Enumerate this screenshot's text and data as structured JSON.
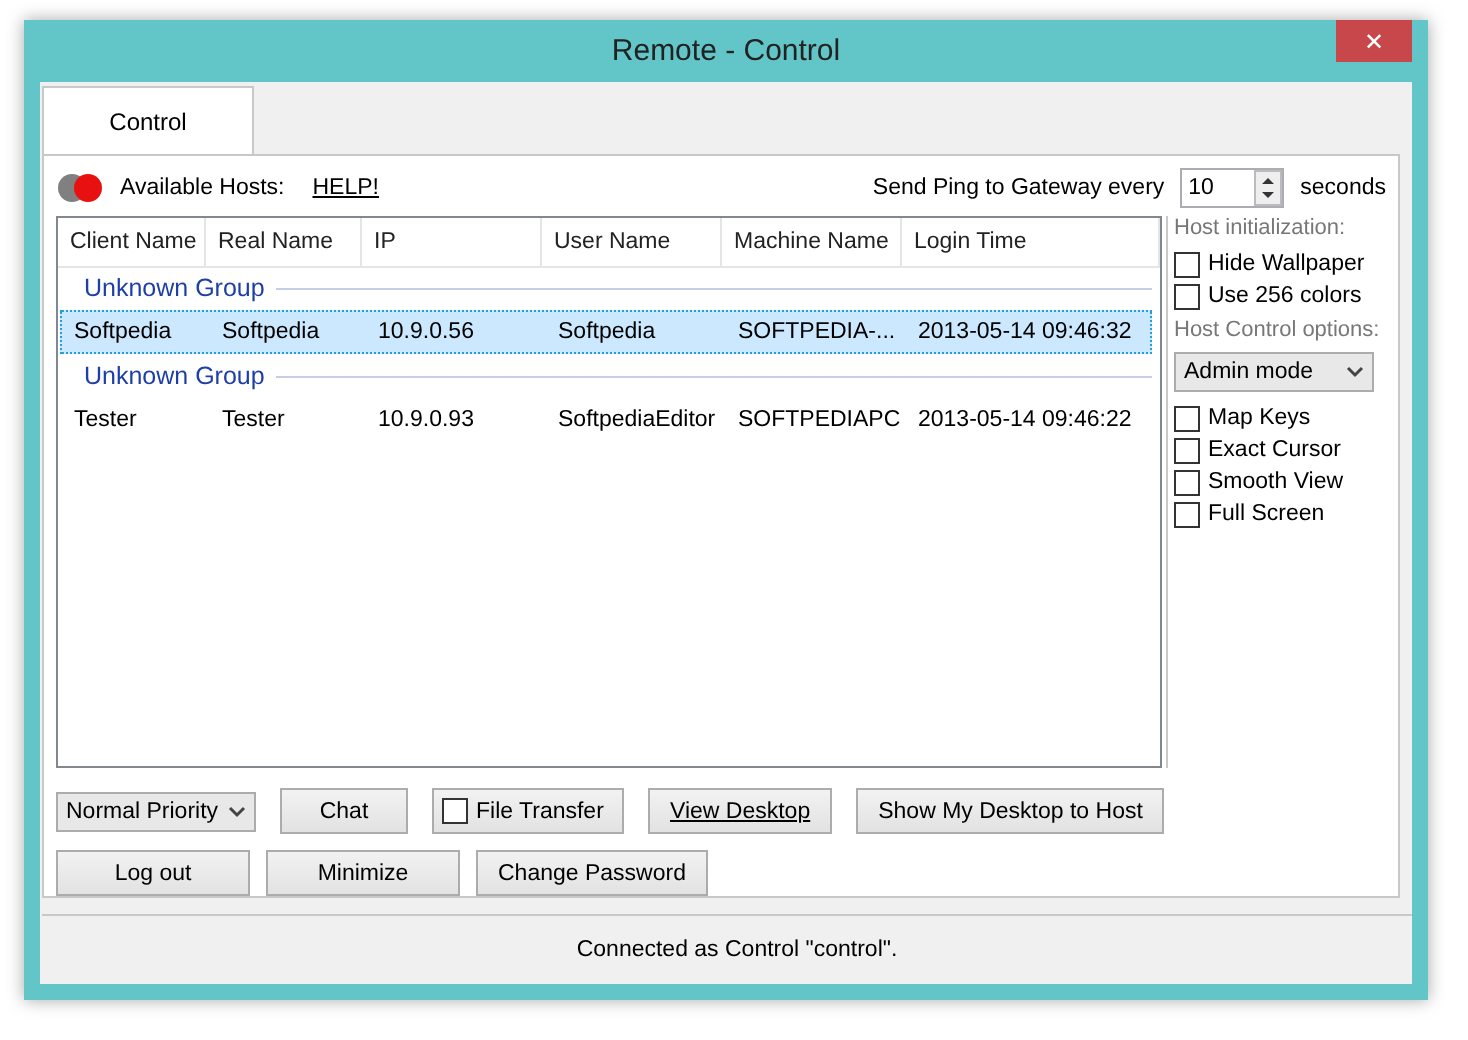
{
  "window": {
    "title": "Remote - Control",
    "close": "✕"
  },
  "tabs": [
    {
      "label": "Control",
      "selected": true
    }
  ],
  "hosts": {
    "label": "Available Hosts:",
    "help": "HELP!"
  },
  "ping": {
    "label": "Send Ping to Gateway every",
    "value": "10",
    "unit": "seconds"
  },
  "table": {
    "columns": [
      "Client Name",
      "Real Name",
      "IP",
      "User Name",
      "Machine Name",
      "Login Time"
    ],
    "groups": [
      {
        "name": "Unknown Group",
        "rows": [
          {
            "selected": true,
            "cells": [
              "Softpedia",
              "Softpedia",
              "10.9.0.56",
              "Softpedia",
              "SOFTPEDIA-...",
              "2013-05-14 09:46:32"
            ]
          }
        ]
      },
      {
        "name": "Unknown Group",
        "rows": [
          {
            "selected": false,
            "cells": [
              "Tester",
              "Tester",
              "10.9.0.93",
              "SoftpediaEditor",
              "SOFTPEDIAPC",
              "2013-05-14 09:46:22"
            ]
          }
        ]
      }
    ]
  },
  "side": {
    "init_label": "Host initialization:",
    "init_options": [
      {
        "label": "Hide Wallpaper",
        "checked": false
      },
      {
        "label": "Use 256 colors",
        "checked": false
      }
    ],
    "control_label": "Host Control options:",
    "mode": "Admin mode",
    "control_options": [
      {
        "label": "Map Keys",
        "checked": false
      },
      {
        "label": "Exact Cursor",
        "checked": false
      },
      {
        "label": "Smooth View",
        "checked": false
      },
      {
        "label": "Full Screen",
        "checked": false
      }
    ]
  },
  "actions": [
    {
      "kind": "select",
      "label": "Normal Priority"
    },
    {
      "kind": "button",
      "label": "Chat"
    },
    {
      "kind": "check",
      "label": "File Transfer",
      "checked": false
    },
    {
      "kind": "link-button",
      "label": "View Desktop"
    },
    {
      "kind": "button",
      "label": "Show My Desktop to Host"
    }
  ],
  "buttons": [
    "Log out",
    "Minimize",
    "Change Password"
  ],
  "status_bar": "Connected as Control \"control\"."
}
